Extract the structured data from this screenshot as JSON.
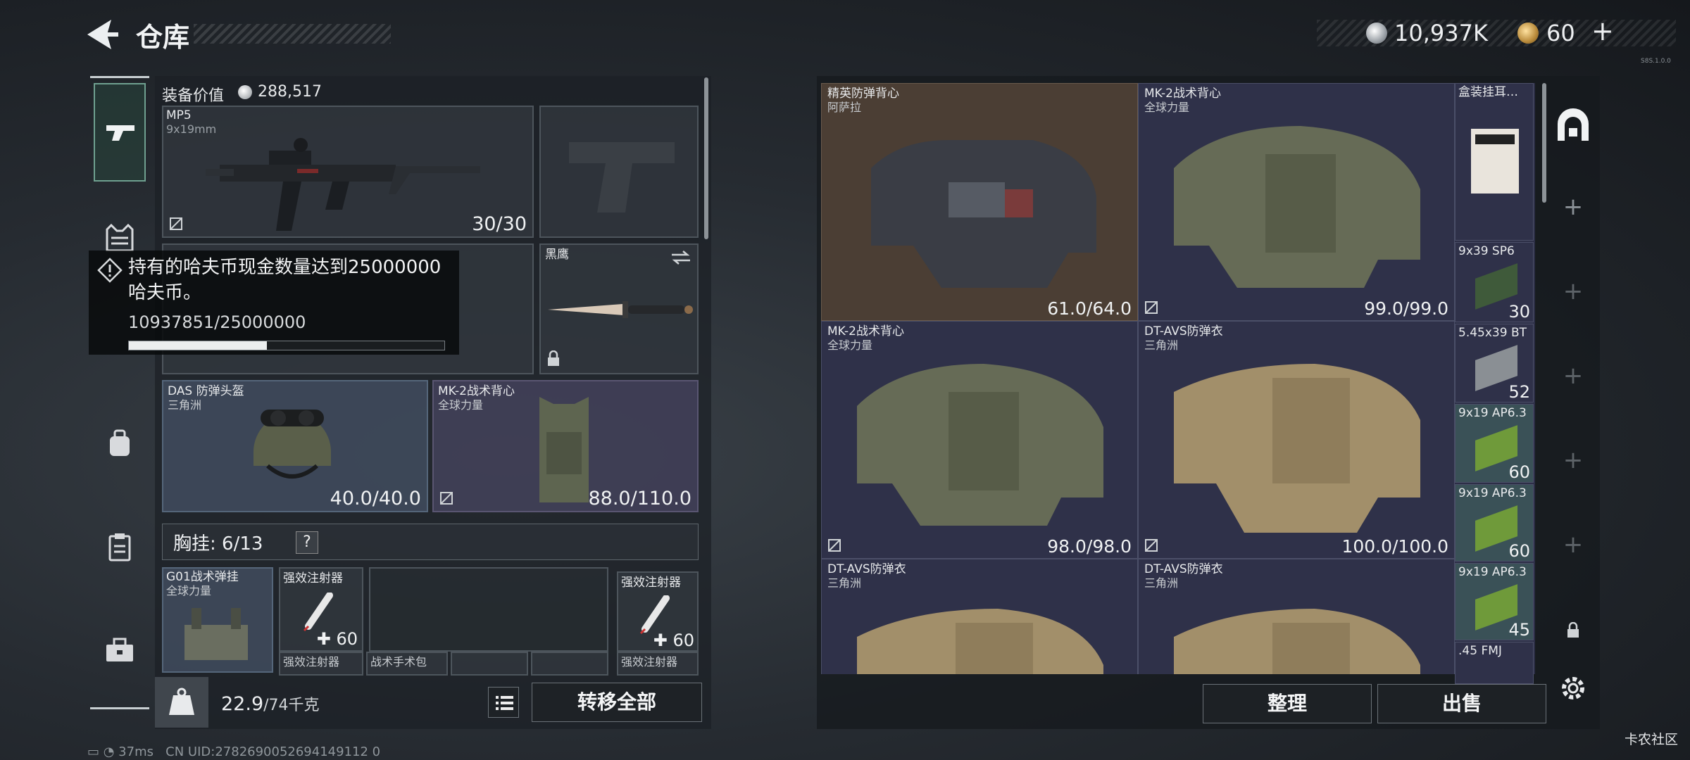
{
  "header": {
    "title": "仓库",
    "money": "10,937K",
    "tickets": "60",
    "plus": "+",
    "tiny_tag": "S8S.1.0.0"
  },
  "left": {
    "value_label": "装备价值",
    "value_amount": "288,517",
    "weapon": {
      "name": "MP5",
      "caliber": "9x19mm",
      "ammo": "30/30"
    },
    "knife": {
      "name": "黑鹰"
    },
    "helmet": {
      "name": "DAS 防弹头盔",
      "sub": "三角洲",
      "durability": "40.0/40.0"
    },
    "armor": {
      "name": "MK-2战术背心",
      "sub": "全球力量",
      "durability": "88.0/110.0"
    },
    "chest_rig": {
      "label": "胸挂: 6/13",
      "help": "?"
    },
    "rig_items": [
      {
        "name": "G01战术弹挂",
        "sub": "全球力量"
      },
      {
        "name": "强效注射器",
        "count": "60"
      },
      {
        "name": "强效注射器",
        "count": "60"
      }
    ],
    "rig_bottom": [
      "强效注射器",
      "战术手术包",
      "强效注射器"
    ],
    "weight": "22.9",
    "weight_max": "/74千克",
    "move_all": "转移全部"
  },
  "notification": {
    "text": "持有的哈夫币现金数量达到25000000哈夫币。",
    "progress_text": "10937851/25000000",
    "progress": 0.4375
  },
  "warehouse": {
    "cells": [
      {
        "name": "精英防弹背心",
        "sub": "阿萨拉",
        "durability": "61.0/64.0"
      },
      {
        "name": "MK-2战术背心",
        "sub": "全球力量",
        "durability": "99.0/99.0"
      },
      {
        "name": "MK-2战术背心",
        "sub": "全球力量",
        "durability": "98.0/98.0"
      },
      {
        "name": "DT-AVS防弹衣",
        "sub": "三角洲",
        "durability": "100.0/100.0"
      },
      {
        "name": "DT-AVS防弹衣",
        "sub": "三角洲",
        "durability": ""
      },
      {
        "name": "DT-AVS防弹衣",
        "sub": "三角洲",
        "durability": ""
      }
    ],
    "ammo": [
      {
        "name": "盒装挂耳…",
        "count": ""
      },
      {
        "name": "9x39 SP6",
        "count": "30"
      },
      {
        "name": "5.45x39 BT",
        "count": "52"
      },
      {
        "name": "9x19 AP6.3",
        "count": "60"
      },
      {
        "name": "9x19 AP6.3",
        "count": "60"
      },
      {
        "name": "9x19 AP6.3",
        "count": "45"
      },
      {
        "name": ".45 FMJ",
        "count": ""
      }
    ],
    "sort": "整理",
    "sell": "出售"
  },
  "status": {
    "ping": "37ms",
    "uid": "CN UID:2782690052694149112 0"
  },
  "watermark": "卡农社区"
}
